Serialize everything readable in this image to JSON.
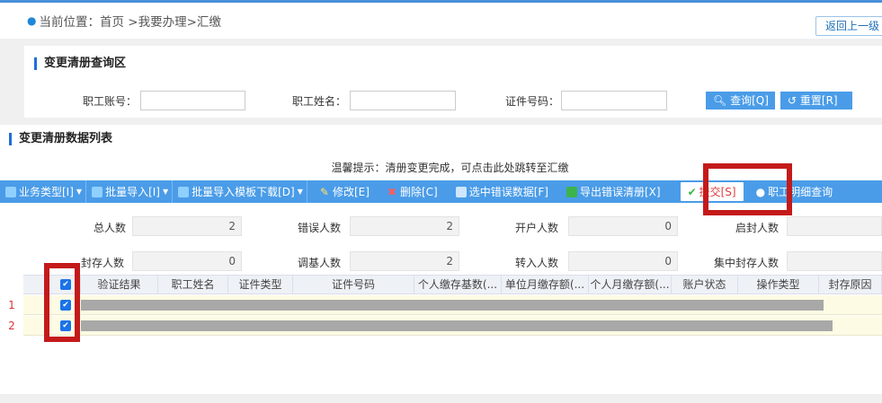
{
  "breadcrumb": {
    "label": "当前位置：",
    "path": "首页 >我要办理>汇缴",
    "back": "返回上一级"
  },
  "query": {
    "title": "变更清册查询区",
    "account_label": "职工账号：",
    "name_label": "职工姓名：",
    "id_label": "证件号码：",
    "search_btn": "查询[Q]",
    "reset_btn": "重置[R]"
  },
  "list": {
    "title": "变更清册数据列表",
    "tip": "温馨提示：清册变更完成，可点击此处跳转至汇缴"
  },
  "toolbar": [
    {
      "label": "业务类型[I]",
      "icon": "business-icon",
      "color": "#8fd0ff",
      "dropdown": true
    },
    {
      "label": "批量导入[I]",
      "icon": "import-icon",
      "color": "#8fd0ff",
      "dropdown": true
    },
    {
      "label": "批量导入模板下载[D]",
      "icon": "download-icon",
      "color": "#8fd0ff",
      "dropdown": true
    },
    {
      "label": "修改[E]",
      "icon": "edit-icon",
      "color": "#ffe066",
      "dropdown": false
    },
    {
      "label": "删除[C]",
      "icon": "delete-icon",
      "color": "#ff5a5a",
      "dropdown": false
    },
    {
      "label": "选中错误数据[F]",
      "icon": "select-error-icon",
      "color": "#cfe6ff",
      "dropdown": false
    },
    {
      "label": "导出错误清册[X]",
      "icon": "export-icon",
      "color": "#3cb44b",
      "dropdown": false
    },
    {
      "label": "提交[S]",
      "icon": "check-icon",
      "color": "#3cb44b",
      "dropdown": false
    },
    {
      "label": "职工明细查询",
      "icon": "search-icon",
      "color": "#ffffff",
      "dropdown": false
    }
  ],
  "stats": {
    "total_label": "总人数",
    "total": "2",
    "error_label": "错误人数",
    "error": "2",
    "open_label": "开户人数",
    "open": "0",
    "unseal_label": "启封人数",
    "unseal": "",
    "seal_label": "封存人数",
    "seal": "0",
    "adjust_label": "调基人数",
    "adjust": "2",
    "transfer_label": "转入人数",
    "transfer": "0",
    "central_label": "集中封存人数",
    "central": ""
  },
  "grid": {
    "columns": [
      "验证结果",
      "职工姓名",
      "证件类型",
      "证件号码",
      "个人缴存基数(...",
      "单位月缴存额(...",
      "个人月缴存额(...",
      "账户状态",
      "操作类型",
      "封存原因"
    ],
    "rows": [
      {
        "num": "1",
        "checked": true
      },
      {
        "num": "2",
        "checked": true
      }
    ]
  },
  "accent": "#4a9ce8",
  "highlight": "#c41a1a"
}
